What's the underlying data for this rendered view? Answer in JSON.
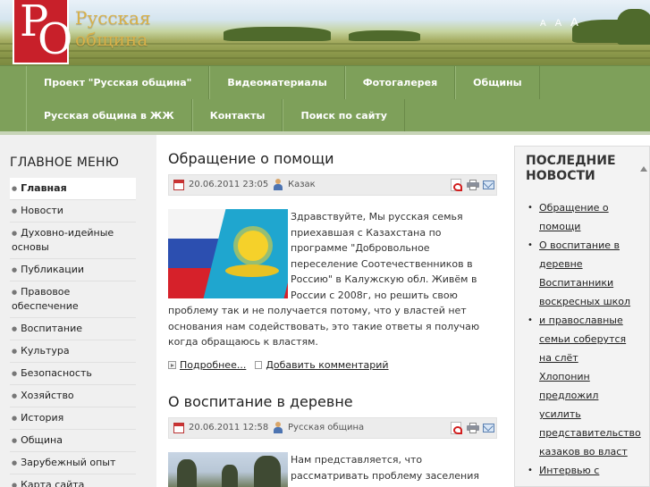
{
  "header": {
    "logo_letters": "РО",
    "site_name_line1": "Русская",
    "site_name_line2": "община",
    "font_sizers": [
      "A",
      "A",
      "A"
    ]
  },
  "nav": {
    "row1": [
      "Проект \"Русская община\"",
      "Видеоматериалы",
      "Фотогалерея",
      "Общины"
    ],
    "row2": [
      "Русская община в ЖЖ",
      "Контакты",
      "Поиск по сайту"
    ]
  },
  "left_menu": {
    "title": "ГЛАВНОЕ МЕНЮ",
    "items": [
      {
        "label": "Главная",
        "active": true
      },
      {
        "label": "Новости"
      },
      {
        "label": "Духовно-идейные основы"
      },
      {
        "label": "Публикации"
      },
      {
        "label": "Правовое обеспечение"
      },
      {
        "label": "Воспитание"
      },
      {
        "label": "Культура"
      },
      {
        "label": "Безопасность"
      },
      {
        "label": "Хозяйство"
      },
      {
        "label": "История"
      },
      {
        "label": "Община"
      },
      {
        "label": "Зарубежный опыт"
      },
      {
        "label": "Карта сайта"
      }
    ]
  },
  "articles": [
    {
      "title": "Обращение о помощи",
      "date": "20.06.2011 23:05",
      "author": "Казак",
      "text": "Здравствуйте, Мы русская семья приехавшая с Казахстана по программе \"Добровольное переселение Соотечественников в Россию\" в Калужскую обл. Живём в России с 2008г, но решить свою проблему так и не получается потому, что у властей нет основания нам содействовать, это такие ответы я получаю когда обращаюсь к властям.",
      "more_label": "Подробнее...",
      "comment_label": "Добавить комментарий"
    },
    {
      "title": "О воспитание в деревне",
      "date": "20.06.2011 12:58",
      "author": "Русская община",
      "text": "Нам представляется, что рассматривать проблему заселения земель Центра"
    }
  ],
  "right_sidebar": {
    "title": "ПОСЛЕДНИЕ НОВОСТИ",
    "items": [
      {
        "text": "Обращение о помощи",
        "bullet": true
      },
      {
        "text": "О воспитание в деревне",
        "bullet": true
      },
      {
        "text": "Воспитанники воскресных школ",
        "bullet": false
      },
      {
        "text": "и православные семьи соберутся на слёт",
        "bullet": true
      },
      {
        "text": "Хлопонин предложил усилить представительство казаков во власт",
        "bullet": false
      },
      {
        "text": "Интервью с",
        "bullet": true
      }
    ]
  }
}
